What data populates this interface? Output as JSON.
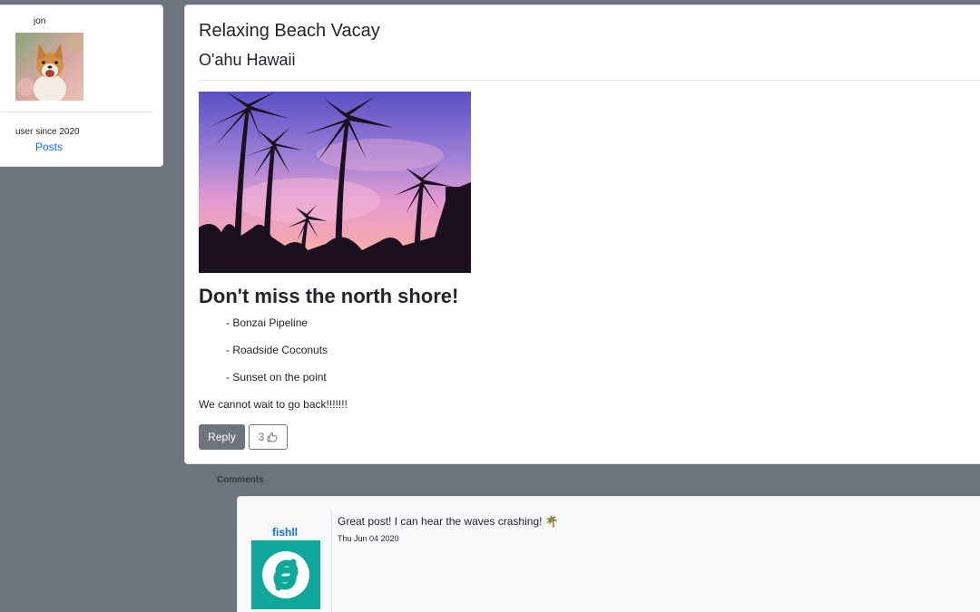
{
  "profile": {
    "username": "jon",
    "avatar_icon": "dog-avatar-icon",
    "member_since": "user since 2020",
    "posts_link": "Posts"
  },
  "post": {
    "title": "Relaxing Beach Vacay",
    "location": "O'ahu Hawaii",
    "image_icon": "palm-sunset-photo",
    "heading": "Don't miss the north shore!",
    "list": [
      "- Bonzai Pipeline",
      "- Roadside Coconuts",
      "- Sunset on the point"
    ],
    "body": "We cannot wait to go back!!!!!!!",
    "reply_label": "Reply",
    "like_count": "3",
    "like_icon": "thumbs-up-icon"
  },
  "comments": {
    "label": "Comments",
    "items": [
      {
        "author": "fishll",
        "avatar_icon": "fedora-logo-avatar",
        "text": "Great post! I can hear the waves crashing! 🌴",
        "date": "Thu Jun 04 2020"
      }
    ]
  },
  "colors": {
    "background": "#6c757d",
    "link": "#0d6efd",
    "button_secondary": "#6c757d",
    "avatar_teal": "#0fa69b"
  }
}
